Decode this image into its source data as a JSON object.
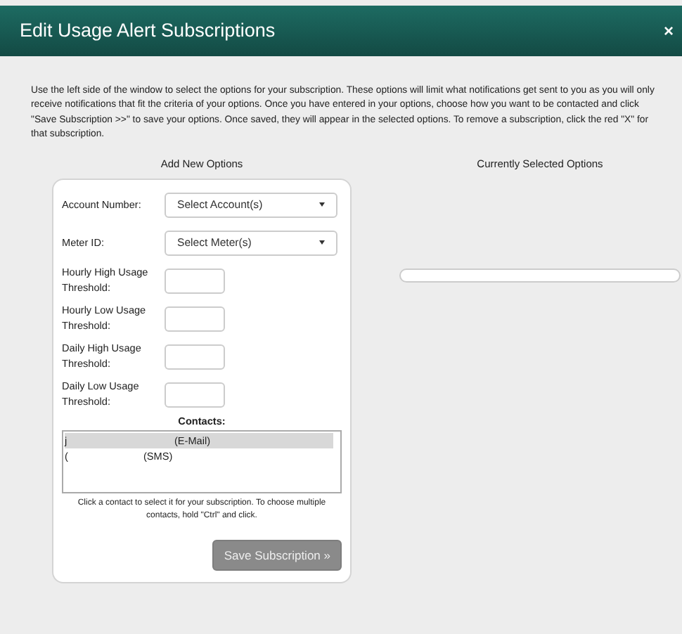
{
  "window": {
    "title": "Edit Usage Alert Subscriptions",
    "close": "×"
  },
  "intro": "Use the left side of the window to select the options for your subscription. These options will limit what notifications get sent to you as you will only receive notifications that fit the criteria of your options. Once you have entered in your options, choose how you want to be contacted and click \"Save Subscription >>\" to save your options. Once saved, they will appear in the selected options. To remove a subscription, click the red \"X\" for that subscription.",
  "add_heading": "Add New Options",
  "selected_heading": "Currently Selected Options",
  "fields": [
    {
      "kind": "select",
      "label": "Account Number:",
      "value": "Select Account(s)"
    },
    {
      "kind": "select",
      "label": "Meter ID:",
      "value": "Select Meter(s)"
    },
    {
      "kind": "input",
      "label": "Hourly High Usage Threshold:"
    },
    {
      "kind": "input",
      "label": "Hourly Low Usage Threshold:"
    },
    {
      "kind": "input",
      "label": "Daily High Usage Threshold:"
    },
    {
      "kind": "input",
      "label": "Daily Low Usage Threshold:"
    }
  ],
  "contacts_label": "Contacts:",
  "contacts": [
    {
      "name": "j",
      "method": "(E-Mail)",
      "selected": true
    },
    {
      "name": "(",
      "method": "(SMS)",
      "selected": false
    }
  ],
  "contacts_help": "Click a contact to select it for your subscription. To choose multiple contacts, hold \"Ctrl\" and click.",
  "save_button": "Save Subscription »"
}
